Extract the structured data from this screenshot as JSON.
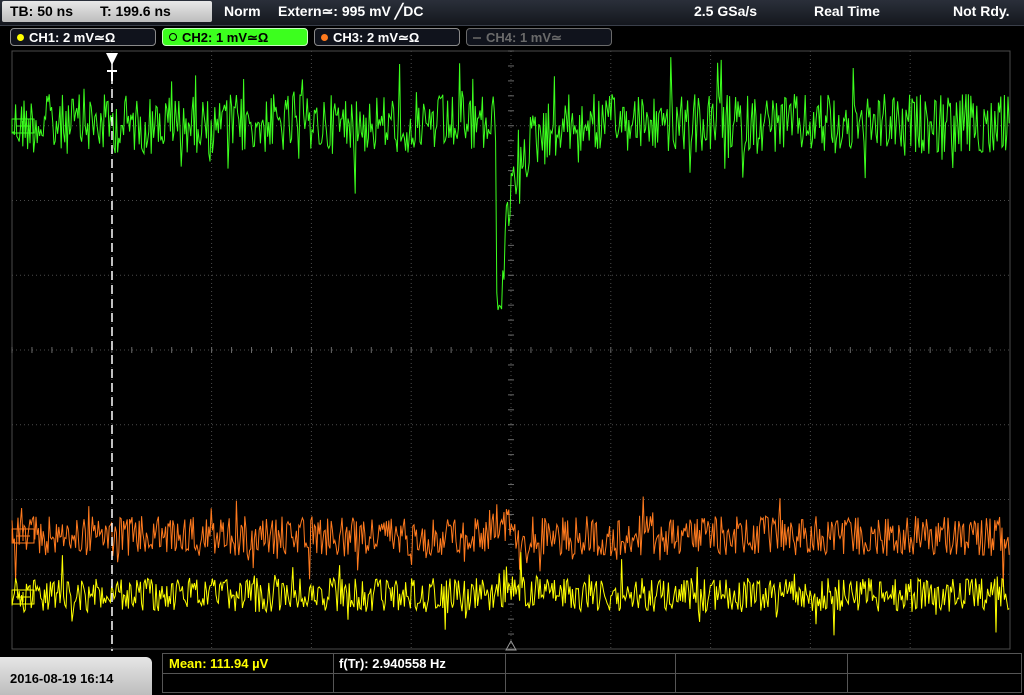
{
  "topbar": {
    "timebase": "TB: 50 ns",
    "trigger_time": "T: 199.6 ns",
    "trigger_mode": "Norm",
    "trigger_source": "Extern≃: 995 mV ╱DC",
    "sample_rate": "2.5 GSa/s",
    "acq_mode": "Real Time",
    "status": "Not Rdy."
  },
  "channels": [
    {
      "label": "CH1: 2 mV≃Ω",
      "color": "#ffff00",
      "state": "normal"
    },
    {
      "label": "CH2: 1 mV≃Ω",
      "color": "#3cff1e",
      "state": "selected"
    },
    {
      "label": "CH3: 2 mV≃Ω",
      "color": "#ff7a1e",
      "state": "normal"
    },
    {
      "label": "CH4: 1 mV≃",
      "color": "#8a8a8a",
      "state": "disabled"
    }
  ],
  "bottombar": {
    "datetime": "2016-08-19 16:14",
    "mean": "Mean: 111.94 µV",
    "trigger_freq": "f(Tr): 2.940558 Hz"
  },
  "colors": {
    "ch1": "#ffff00",
    "ch2": "#3cff1e",
    "ch3": "#ff7a1e",
    "grid": "#4a4a4a",
    "background": "#000000"
  }
}
